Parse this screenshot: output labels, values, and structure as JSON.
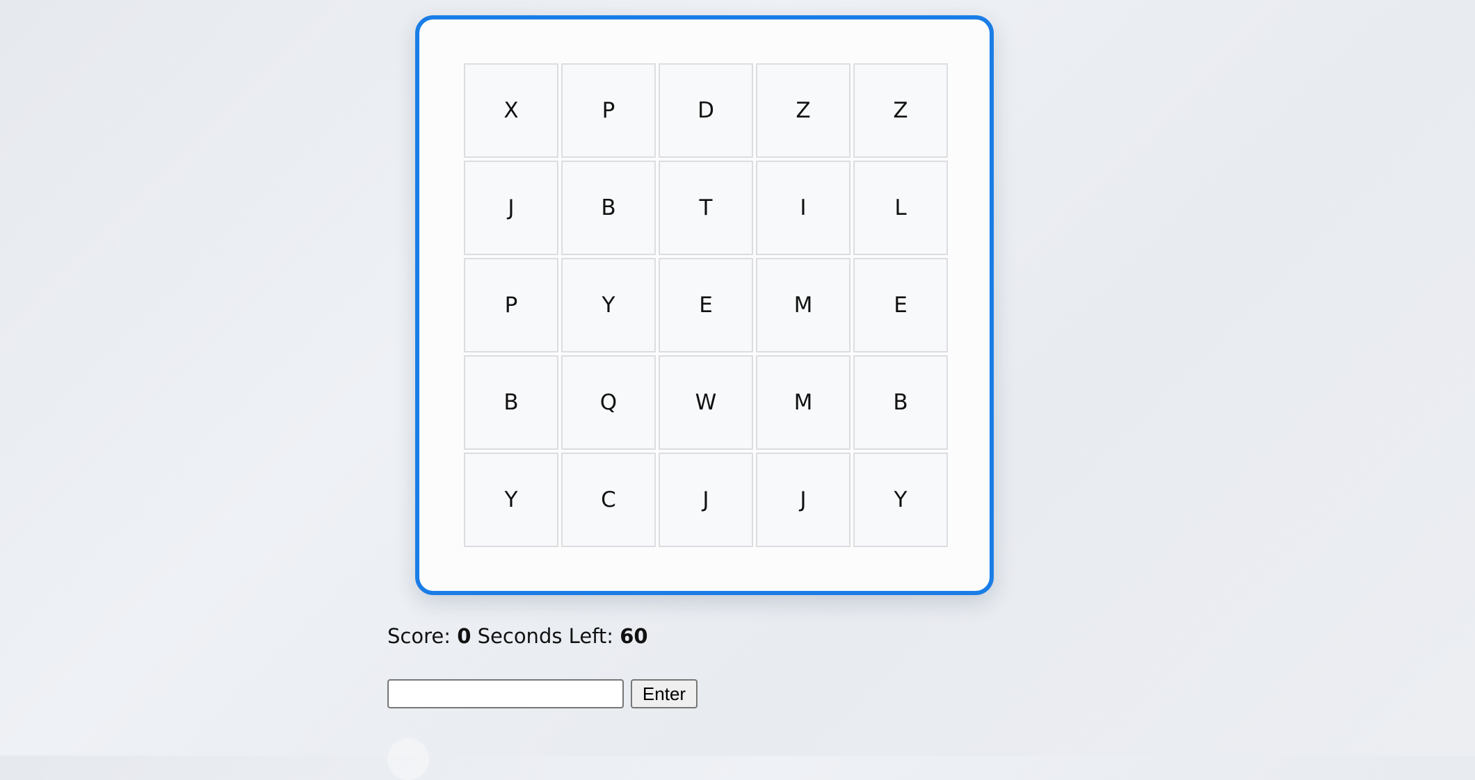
{
  "board": {
    "accent_color": "#1a7de6",
    "rows": [
      [
        "X",
        "P",
        "D",
        "Z",
        "Z"
      ],
      [
        "J",
        "B",
        "T",
        "I",
        "L"
      ],
      [
        "P",
        "Y",
        "E",
        "M",
        "E"
      ],
      [
        "B",
        "Q",
        "W",
        "M",
        "B"
      ],
      [
        "Y",
        "C",
        "J",
        "J",
        "Y"
      ]
    ]
  },
  "status": {
    "score_label": "Score:",
    "score_value": "0",
    "seconds_label": "Seconds Left:",
    "seconds_value": "60"
  },
  "input": {
    "value": "",
    "button_label": "Enter"
  }
}
